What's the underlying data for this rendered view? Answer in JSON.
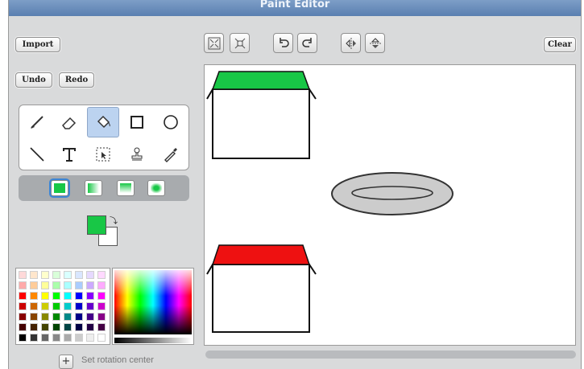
{
  "window": {
    "title": "Paint Editor"
  },
  "buttons": {
    "import": "Import",
    "undo": "Undo",
    "redo": "Redo",
    "clear": "Clear"
  },
  "toolbar": [
    "grow-icon",
    "shrink-icon",
    "rotate-left-icon",
    "rotate-right-icon",
    "flip-horizontal-icon",
    "flip-vertical-icon"
  ],
  "tools": [
    "paintbrush",
    "eraser",
    "fill",
    "rectangle",
    "ellipse",
    "line",
    "text",
    "select",
    "stamp",
    "eyedropper"
  ],
  "selected_tool": "fill",
  "fill_modes": [
    "solid",
    "horizontal-gradient",
    "vertical-gradient",
    "radial-gradient"
  ],
  "selected_fill_mode": "solid",
  "colors": {
    "foreground": "#18c746",
    "background": "#ffffff",
    "roof_green": "#18c746",
    "roof_red": "#ee1111",
    "ellipse_fill": "#cccccc"
  },
  "rotation": {
    "label": "Set rotation center"
  },
  "palette": [
    "#ffd9d9",
    "#ffe6cc",
    "#ffffcc",
    "#d9ffd9",
    "#d9ffff",
    "#d9e6ff",
    "#e6d9ff",
    "#ffd9ff",
    "#ffaaaa",
    "#ffcc99",
    "#ffff99",
    "#aaffaa",
    "#aaffff",
    "#aaccff",
    "#ccaaff",
    "#ffaaff",
    "#ff0000",
    "#ff8800",
    "#ffff00",
    "#00ff00",
    "#00ffff",
    "#0000ff",
    "#8800ff",
    "#ff00ff",
    "#cc0000",
    "#cc6600",
    "#cccc00",
    "#00cc00",
    "#00cccc",
    "#0000cc",
    "#6600cc",
    "#cc00cc",
    "#880000",
    "#884400",
    "#888800",
    "#008800",
    "#008888",
    "#000088",
    "#440088",
    "#880088",
    "#440000",
    "#442200",
    "#444400",
    "#004400",
    "#004444",
    "#000044",
    "#220044",
    "#440044",
    "#000000",
    "#333333",
    "#666666",
    "#888888",
    "#aaaaaa",
    "#cccccc",
    "#eeeeee",
    "#ffffff"
  ]
}
